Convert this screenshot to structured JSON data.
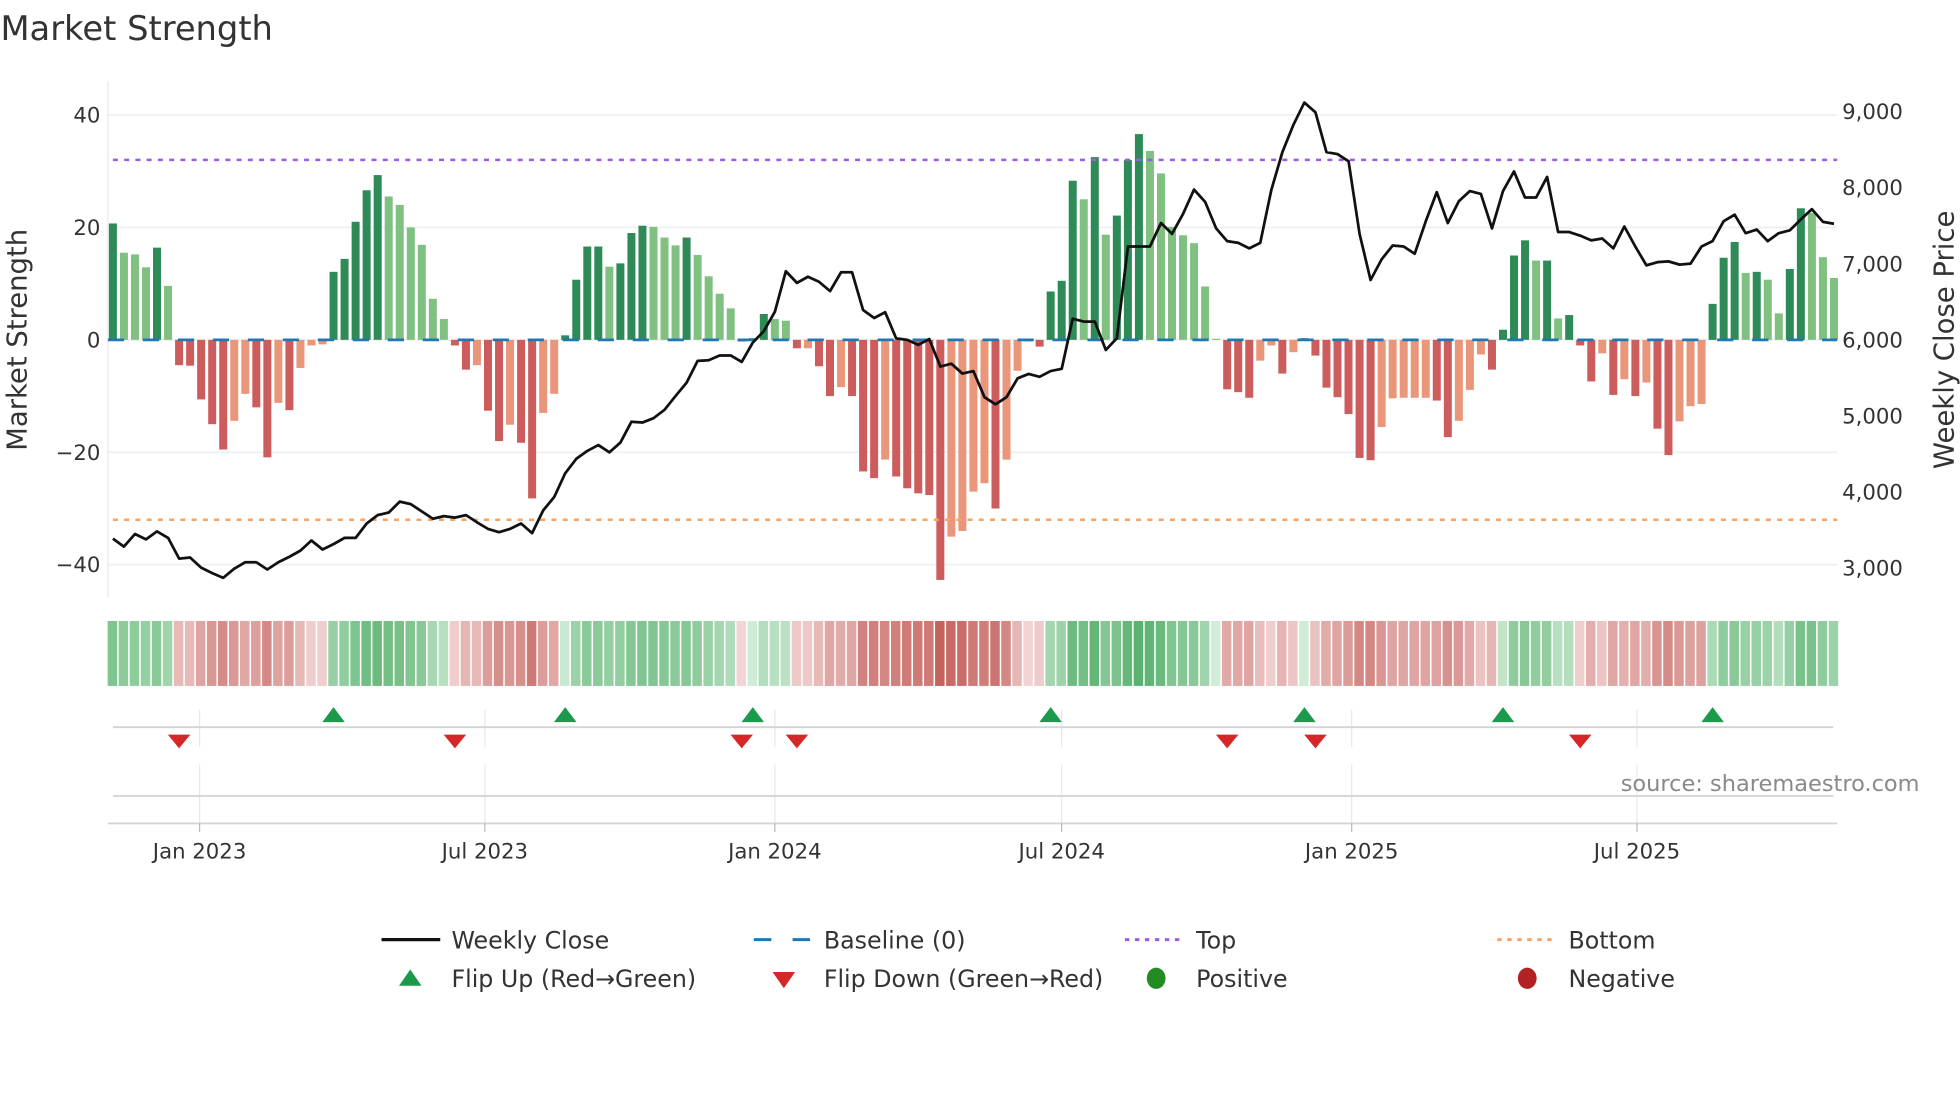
{
  "title": "Market Strength",
  "source": "source: sharemaestro.com",
  "colors": {
    "pos_rising": "#2e8b57",
    "pos_falling": "#80c080",
    "neg_falling": "#cd5c5c",
    "neg_rising": "#e9967a",
    "close_line": "#111111",
    "baseline": "#1f77b4",
    "top": "#9b5de5",
    "bottom": "#f4a460",
    "flip_up": "#1a9a4a",
    "flip_down": "#d62728",
    "positive": "#228b22",
    "negative": "#b22222"
  },
  "legend": {
    "weekly_close": "Weekly Close",
    "baseline": "Baseline (0)",
    "top": "Top",
    "bottom": "Bottom",
    "flip_up": "Flip Up (Red→Green)",
    "flip_down": "Flip Down (Green→Red)",
    "positive": "Positive",
    "negative": "Negative"
  },
  "chart_data": {
    "type": "bar",
    "title": "Market Strength",
    "ylabel": "Market Strength",
    "y2label": "Weekly Close Price",
    "ylim": [
      -46,
      46
    ],
    "y2lim": [
      2600,
      9200
    ],
    "grid": true,
    "legend_position": "bottom",
    "x_start": "2022-11-07",
    "x_step_days": 7,
    "y_ticks": [
      "40",
      "20",
      "0",
      "−20",
      "−40"
    ],
    "y_tick_values": [
      40,
      20,
      0,
      -20,
      -40
    ],
    "y2_ticks": [
      "9,000",
      "8,000",
      "7,000",
      "6,000",
      "5,000",
      "4,000",
      "3,000"
    ],
    "y2_tick_values": [
      9000,
      8000,
      7000,
      6000,
      5000,
      4000,
      3000
    ],
    "x_ticks": [
      {
        "label": "Jan 2023",
        "date": "2023-01-01"
      },
      {
        "label": "Jul 2023",
        "date": "2023-07-01"
      },
      {
        "label": "Jan 2024",
        "date": "2024-01-01"
      },
      {
        "label": "Jul 2024",
        "date": "2024-07-01"
      },
      {
        "label": "Jan 2025",
        "date": "2025-01-01"
      },
      {
        "label": "Jul 2025",
        "date": "2025-07-01"
      }
    ],
    "top_level": 32,
    "bottom_level": -32,
    "baseline": 0,
    "series": [
      {
        "name": "Market Strength",
        "values": [
          20.7,
          15.5,
          15.2,
          12.9,
          16.4,
          9.6,
          -4.5,
          -4.6,
          -10.6,
          -15,
          -19.5,
          -14.4,
          -9.6,
          -12,
          -20.9,
          -11.2,
          -12.5,
          -5,
          -1,
          -0.8,
          12.1,
          14.4,
          21,
          26.6,
          29.3,
          25.5,
          24,
          20,
          16.9,
          7.3,
          3.7,
          -1,
          -5.3,
          -4.5,
          -12.6,
          -18,
          -15.1,
          -18.3,
          -28.2,
          -13,
          -9.6,
          0.8,
          10.7,
          16.6,
          16.6,
          13,
          13.6,
          19,
          20.3,
          20.1,
          18.2,
          16.8,
          18.2,
          15.1,
          11.3,
          8.2,
          5.6,
          -0.3,
          0.3,
          4.6,
          3.7,
          3.4,
          -1.5,
          -1.5,
          -4.7,
          -10,
          -8.4,
          -10,
          -23.4,
          -24.6,
          -21.3,
          -24.3,
          -26.4,
          -27.3,
          -27.6,
          -42.7,
          -35,
          -34,
          -27,
          -25.5,
          -30,
          -21.3,
          -5.5,
          -0.3,
          -1.2,
          8.6,
          10.5,
          28.3,
          25,
          32.5,
          18.7,
          22.1,
          32,
          36.6,
          33.6,
          29.6,
          20.1,
          18.6,
          17.2,
          9.5,
          0.2,
          -8.8,
          -9.3,
          -10.3,
          -3.7,
          -1,
          -6,
          -2.2,
          0.3,
          -2.8,
          -8.5,
          -10.2,
          -13.2,
          -21,
          -21.4,
          -15.5,
          -10.4,
          -10.3,
          -10.3,
          -10.3,
          -10.8,
          -17.3,
          -14.4,
          -8.9,
          -2.6,
          -5.3,
          1.8,
          15,
          17.7,
          14.1,
          14.1,
          3.8,
          4.4,
          -1,
          -7.4,
          -2.4,
          -9.8,
          -7,
          -10,
          -7.6,
          -15.8,
          -20.5,
          -14.5,
          -11.8,
          -11.4,
          6.4,
          14.6,
          17.4,
          11.9,
          12.1,
          10.7,
          4.7,
          12.6,
          23.4,
          22.6,
          14.7,
          11
        ]
      },
      {
        "name": "Weekly Close",
        "axis": "right",
        "values": [
          3387,
          3282,
          3449,
          3378,
          3482,
          3397,
          3125,
          3139,
          3006,
          2934,
          2872,
          2991,
          3077,
          3077,
          2982,
          3077,
          3149,
          3230,
          3363,
          3244,
          3316,
          3397,
          3397,
          3587,
          3697,
          3730,
          3873,
          3840,
          3745,
          3649,
          3683,
          3664,
          3697,
          3602,
          3516,
          3473,
          3516,
          3587,
          3459,
          3759,
          3935,
          4246,
          4436,
          4541,
          4618,
          4522,
          4651,
          4923,
          4913,
          4970,
          5080,
          5261,
          5438,
          5724,
          5733,
          5795,
          5795,
          5710,
          5962,
          6115,
          6368,
          6902,
          6749,
          6830,
          6764,
          6640,
          6888,
          6888,
          6392,
          6287,
          6363,
          6020,
          6000,
          5934,
          6010,
          5648,
          5686,
          5557,
          5590,
          5247,
          5152,
          5247,
          5495,
          5552,
          5514,
          5590,
          5619,
          6277,
          6239,
          6239,
          5867,
          6020,
          7226,
          7226,
          7226,
          7536,
          7392,
          7655,
          7975,
          7813,
          7464,
          7298,
          7274,
          7202,
          7274,
          7965,
          8466,
          8824,
          9119,
          8990,
          8466,
          8442,
          8347,
          7392,
          6787,
          7059,
          7240,
          7226,
          7131,
          7560,
          7941,
          7536,
          7822,
          7956,
          7918,
          7464,
          7956,
          8213,
          7870,
          7870,
          8142,
          7417,
          7417,
          7369,
          7307,
          7331,
          7202,
          7489,
          7226,
          6978,
          7021,
          7031,
          6988,
          7002,
          7226,
          7298,
          7560,
          7646,
          7402,
          7450,
          7298,
          7402,
          7440,
          7583,
          7717,
          7550,
          7526
        ]
      }
    ]
  }
}
